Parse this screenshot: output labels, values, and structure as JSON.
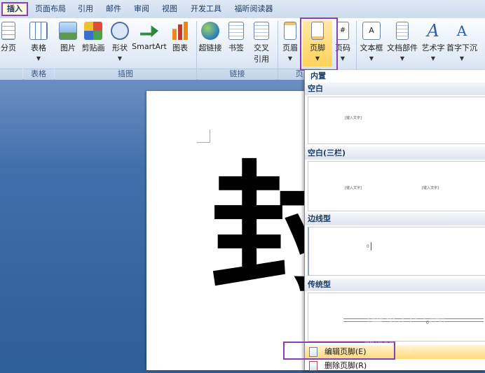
{
  "tabs": [
    "插入",
    "页面布局",
    "引用",
    "邮件",
    "审阅",
    "视图",
    "开发工具",
    "福昕阅读器"
  ],
  "ribbon": {
    "buttons": [
      {
        "label": "分页",
        "icon": "page-break-icon"
      },
      {
        "label": "表格",
        "icon": "table-icon"
      },
      {
        "label": "图片",
        "icon": "picture-icon"
      },
      {
        "label": "剪贴画",
        "icon": "clipart-icon"
      },
      {
        "label": "形状",
        "icon": "shapes-icon"
      },
      {
        "label": "SmartArt",
        "icon": "smartart-icon"
      },
      {
        "label": "图表",
        "icon": "chart-icon"
      },
      {
        "label": "超链接",
        "icon": "hyperlink-icon"
      },
      {
        "label": "书签",
        "icon": "bookmark-icon"
      },
      {
        "label": "交叉引用",
        "icon": "cross-reference-icon"
      },
      {
        "label": "页眉",
        "icon": "header-icon"
      },
      {
        "label": "页脚",
        "icon": "footer-icon"
      },
      {
        "label": "页码",
        "icon": "page-number-icon"
      },
      {
        "label": "文本框",
        "icon": "textbox-icon"
      },
      {
        "label": "文档部件",
        "icon": "quick-parts-icon"
      },
      {
        "label": "艺术字",
        "icon": "wordart-icon"
      },
      {
        "label": "首字下沉",
        "icon": "dropcap-icon"
      }
    ],
    "cross_ref_line1": "交叉",
    "cross_ref_line2": "引用",
    "groups": {
      "table": "表格",
      "illustrations": "插图",
      "links": "链接",
      "headerfooter": "页"
    }
  },
  "document": {
    "large_text": "封"
  },
  "gallery": {
    "section_builtin": "内置",
    "items": [
      {
        "title": "空白",
        "placeholders": [
          "[键入文字]"
        ]
      },
      {
        "title": "空白(三栏)",
        "placeholders": [
          "[键入文字]",
          "[键入文字]"
        ]
      },
      {
        "title": "边线型",
        "placeholders": [
          "0"
        ]
      },
      {
        "title": "传统型",
        "placeholders": [
          "0"
        ]
      }
    ],
    "menu": {
      "edit_footer": "编辑页脚(E)",
      "remove_footer": "删除页脚(R)"
    }
  },
  "watermark": {
    "main": "搜狗指南",
    "url": "zhinan.sogou.com"
  },
  "colors": {
    "highlight": "#8b3fb3",
    "ribbon_bg": "#e3ecf8",
    "doc_bg": "#2f5f99"
  }
}
